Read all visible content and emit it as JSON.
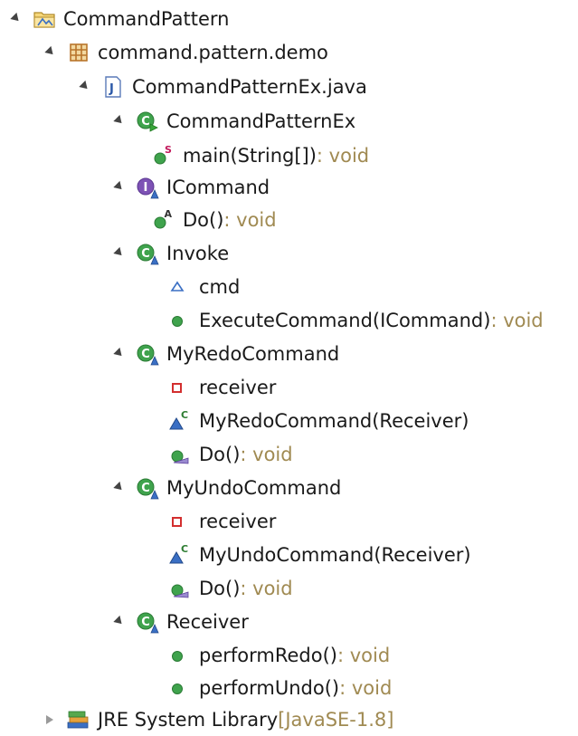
{
  "tree": {
    "project": {
      "label": "CommandPattern"
    },
    "package": {
      "label": "command.pattern.demo"
    },
    "file": {
      "label": "CommandPatternEx.java"
    },
    "classes": [
      {
        "label": "CommandPatternEx",
        "members": [
          {
            "label": "main(String[])",
            "suffix": " : void",
            "icon": "static-method-icon"
          }
        ]
      },
      {
        "label": "ICommand",
        "members": [
          {
            "label": "Do()",
            "suffix": " : void",
            "icon": "abstract-method-icon"
          }
        ]
      },
      {
        "label": "Invoke",
        "members": [
          {
            "label": "cmd",
            "suffix": "",
            "icon": "default-field-icon"
          },
          {
            "label": "ExecuteCommand(ICommand)",
            "suffix": " : void",
            "icon": "public-method-icon"
          }
        ]
      },
      {
        "label": "MyRedoCommand",
        "members": [
          {
            "label": "receiver",
            "suffix": "",
            "icon": "private-field-icon"
          },
          {
            "label": "MyRedoCommand(Receiver)",
            "suffix": "",
            "icon": "constructor-icon"
          },
          {
            "label": "Do()",
            "suffix": " : void",
            "icon": "override-method-icon"
          }
        ]
      },
      {
        "label": "MyUndoCommand",
        "members": [
          {
            "label": "receiver",
            "suffix": "",
            "icon": "private-field-icon"
          },
          {
            "label": "MyUndoCommand(Receiver)",
            "suffix": "",
            "icon": "constructor-icon"
          },
          {
            "label": "Do()",
            "suffix": " : void",
            "icon": "override-method-icon"
          }
        ]
      },
      {
        "label": "Receiver",
        "members": [
          {
            "label": "performRedo()",
            "suffix": " : void",
            "icon": "public-method-icon"
          },
          {
            "label": "performUndo()",
            "suffix": " : void",
            "icon": "public-method-icon"
          }
        ]
      }
    ],
    "library": {
      "label": "JRE System Library",
      "suffix": " [JavaSE-1.8]"
    }
  }
}
